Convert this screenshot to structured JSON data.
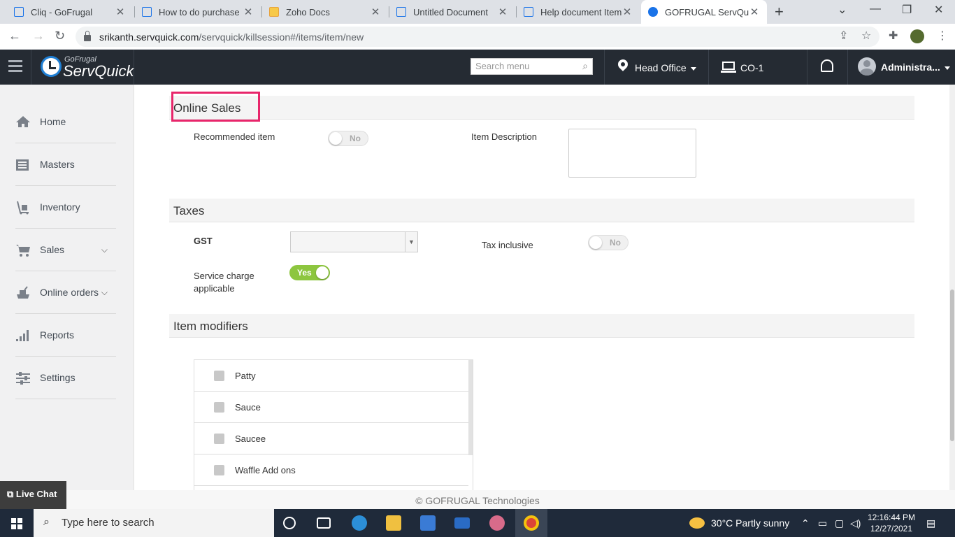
{
  "browser": {
    "tabs": [
      {
        "title": "Cliq - GoFrugal"
      },
      {
        "title": "How to do purchase re"
      },
      {
        "title": "Zoho Docs"
      },
      {
        "title": "Untitled Document"
      },
      {
        "title": "Help document Item r"
      },
      {
        "title": "GOFRUGAL ServQuick"
      }
    ],
    "url_host": "srikanth.servquick.com",
    "url_path": "/servquick/killsession#/items/item/new"
  },
  "header": {
    "logo_small": "GoFrugal",
    "logo_big": "ServQuick",
    "search_placeholder": "Search menu",
    "location": "Head Office",
    "counter": "CO-1",
    "user": "Administra..."
  },
  "sidebar": {
    "items": [
      {
        "label": "Home"
      },
      {
        "label": "Masters"
      },
      {
        "label": "Inventory"
      },
      {
        "label": "Sales"
      },
      {
        "label": "Online orders"
      },
      {
        "label": "Reports"
      },
      {
        "label": "Settings"
      }
    ]
  },
  "online_sales": {
    "title": "Online Sales",
    "recommended_label": "Recommended item",
    "recommended_value": "No",
    "description_label": "Item Description",
    "description_value": ""
  },
  "taxes": {
    "title": "Taxes",
    "gst_label": "GST",
    "gst_value": "",
    "tax_inclusive_label": "Tax inclusive",
    "tax_inclusive_value": "No",
    "service_charge_label_1": "Service charge",
    "service_charge_label_2": "applicable",
    "service_charge_value": "Yes"
  },
  "modifiers": {
    "title": "Item modifiers",
    "items": [
      {
        "label": "Patty"
      },
      {
        "label": "Sauce"
      },
      {
        "label": "Saucee"
      },
      {
        "label": "Waffle Add ons"
      }
    ]
  },
  "footer": "© GOFRUGAL Technologies",
  "live_chat": "Live Chat",
  "taskbar": {
    "search_placeholder": "Type here to search",
    "weather": "30°C  Partly sunny",
    "time": "12:16:44 PM",
    "date": "12/27/2021"
  },
  "colors": {
    "header_bg": "#252b33",
    "toggle_on": "#8dc63f",
    "highlight": "#e8266b"
  }
}
